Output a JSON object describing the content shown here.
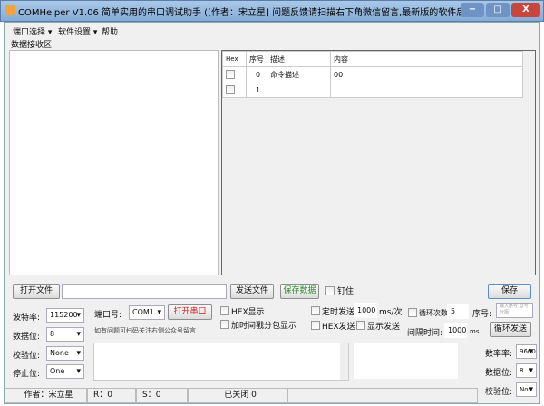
{
  "window": {
    "title": "COMHelper V1.06 简单实用的串口调试助手 ([作者：宋立星] 问题反馈请扫描右下角微信留言,最新版的软件后台回复 \"串口调试助...",
    "min": "−",
    "max": "□",
    "close": "X"
  },
  "menu": [
    {
      "label": "端口选择 ▾"
    },
    {
      "label": "软件设置 ▾"
    },
    {
      "label": "帮助"
    }
  ],
  "receive": {
    "label": "数据接收区"
  },
  "table": {
    "headers": [
      "Hex",
      "序号",
      "描述",
      "内容"
    ],
    "rows": [
      {
        "index": "0",
        "desc": "命令描述",
        "content": "00"
      },
      {
        "index": "1",
        "desc": "",
        "content": ""
      }
    ]
  },
  "toolbar": {
    "open_file": "打开文件",
    "file_path": "",
    "send_file": "发送文件",
    "save_data": "保存数据",
    "pin": "钉住",
    "save": "保存"
  },
  "serial": {
    "baud_label": "波特率:",
    "baud": "115200",
    "databits_label": "数据位:",
    "databits": "8",
    "parity_label": "校验位:",
    "parity": "None",
    "stopbits_label": "停止位:",
    "stopbits": "One",
    "port_label": "端口号:",
    "port": "COM1",
    "open_port": "打开串口",
    "hint": "如有问题可扫码关注右侧公众号留言"
  },
  "options": {
    "hex_display": "HEX显示",
    "timestamp": "加时间戳分包显示",
    "timed_send": "定时发送",
    "timed_value": "1000",
    "timed_unit": "ms/次",
    "hex_send": "HEX发送",
    "show_send": "显示发送",
    "loop_count_label": "循环次数",
    "loop_count": "5",
    "seq_label": "序号:",
    "seq_placeholder": "输入序号 逗号分隔",
    "interval_label": "间隔时间:",
    "interval": "1000",
    "interval_unit": "ms",
    "loop_send": "循环发送"
  },
  "right": {
    "rate_label": "数率率:",
    "rate": "9600",
    "databits_label": "数据位:",
    "databits": "8",
    "parity_label": "校验位:",
    "parity": "Non"
  },
  "status": {
    "author": "作者：宋立星",
    "r": "R：0",
    "s": "S：0",
    "state": "已关闭 0"
  }
}
